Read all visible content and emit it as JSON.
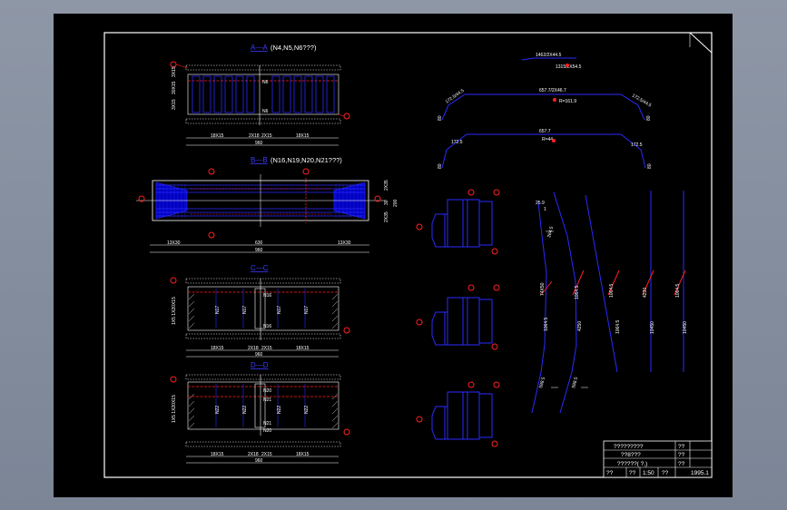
{
  "colors": {
    "background_gray": "#8a93a3",
    "sheet": "#000000",
    "frame": "#ffffff",
    "rebar": "#1a1aff",
    "section_fill": "#0000cc",
    "callout": "#ff2020",
    "dim": "#ffffff"
  },
  "views": {
    "top": {
      "title_prefix": "A—A",
      "title_suffix": "(N4,N5,N6???)",
      "labels": {
        "n6_top": "N6",
        "n6_bottom": "N6",
        "dim_left": "18X15",
        "dim_mid": "2X18",
        "dim_mid2": "2X15",
        "dim_right": "18X15",
        "dim_total": "960",
        "side": "3X15",
        "side2": "30X15",
        "side3": "3X15"
      }
    },
    "plan": {
      "title_prefix": "B—B",
      "title_suffix": "(N16,N19,N20,N21???)",
      "labels": {
        "dim_left": "13X30",
        "dim_mid": "630",
        "dim_right": "13X30",
        "dim_total": "960",
        "side": "2X35",
        "side2": "30",
        "side3": "2X35",
        "height": "200"
      }
    },
    "c_section": {
      "title": "C—C",
      "labels": {
        "n16_a": "N16",
        "n16_b": "N16",
        "n17_a": "N17",
        "n17_b": "N17",
        "n17_c": "N17",
        "n17_d": "N17",
        "dim_left": "18X15",
        "dim_mid": "2X18",
        "dim_mid2": "2X15",
        "dim_right": "18X15",
        "dim_total": "960",
        "side": "1X5  1X20X15"
      }
    },
    "d_section": {
      "title": "D—D",
      "labels": {
        "n20_a": "N20",
        "n20_b": "N20",
        "n21_a": "N21",
        "n21_b": "N21",
        "n22_a": "N22",
        "n22_b": "N22",
        "n22_c": "N22",
        "n22_d": "N22",
        "dim_left": "18X15",
        "dim_mid": "2X18",
        "dim_mid2": "2X15",
        "dim_right": "18X15",
        "dim_total": "960",
        "side": "1X5  1X20X15"
      }
    },
    "rebar_shapes": {
      "top_bar_1": "1462/2X44.5",
      "top_bar_2": "1315/2X54.5",
      "mid_bar": "657.7/2X46.7",
      "mid_sub": "R=161.9",
      "mid_left": "172.5/44.5",
      "mid_right": "172.5/44.5",
      "mid_left_v": "80",
      "mid_right_v": "80",
      "bot_bar": "657.7",
      "bot_sub": "R=44",
      "bot_left": "172.5",
      "bot_right": "172.5",
      "bot_left_v": "80",
      "bot_right_v": "80"
    },
    "long_bars": {
      "bar1_top": "25.9",
      "bar1_top2": "1",
      "bar1_mid": "264.5",
      "bar2_mid": "1064.5",
      "bar3_mid": "1064.5",
      "bar4_mid": "4230",
      "bar5_mid": "1064.5",
      "bar1_len": "74X50",
      "bar2_len": "1064.5",
      "bar3_len": "4250",
      "bar4_len": "1064.5",
      "bar5_len": "10450",
      "bar1_bot": "598.5",
      "bar2_bot": "598.5"
    }
  },
  "title_block": {
    "row1_left": "?????????",
    "row1_right": "??",
    "row2_left": "??8???",
    "row2_right": "??",
    "row3_left": "??????( ?,)",
    "row3_right": "??",
    "row4_a": "??",
    "row4_b": "??",
    "row4_c": "1:50",
    "row4_d": "??",
    "row4_e": "1995.1"
  }
}
